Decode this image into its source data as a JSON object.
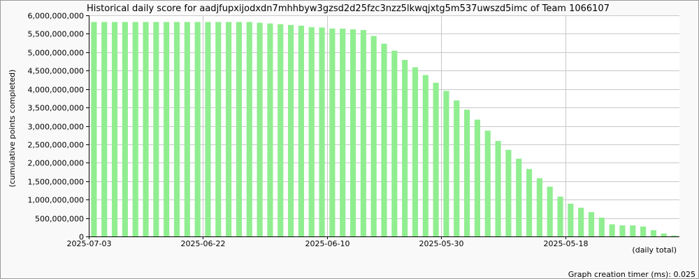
{
  "chart_data": {
    "type": "bar",
    "title": "Historical daily score for aadjfupxijodxdn7mhhbyw3gzsd2d25fzc3nzz5lkwqjxtg5m537uwszd5imc of Team 1066107",
    "xlabel": "(daily total)",
    "ylabel": "(cumulative points completed)",
    "ylim": [
      0,
      6000000000
    ],
    "yticks": [
      0,
      500000000,
      1000000000,
      1500000000,
      2000000000,
      2500000000,
      3000000000,
      3500000000,
      4000000000,
      4500000000,
      5000000000,
      5500000000,
      6000000000
    ],
    "ytick_labels": [
      "0",
      "500,000,000",
      "1,000,000,000",
      "1,500,000,000",
      "2,000,000,000",
      "2,500,000,000",
      "3,000,000,000",
      "3,500,000,000",
      "4,000,000,000",
      "4,500,000,000",
      "5,000,000,000",
      "5,500,000,000",
      "6,000,000,000"
    ],
    "xtick_labels": [
      {
        "index": 0,
        "label": "2025-07-03"
      },
      {
        "index": 11,
        "label": "2025-06-22"
      },
      {
        "index": 23,
        "label": "2025-06-10"
      },
      {
        "index": 34,
        "label": "2025-05-30"
      },
      {
        "index": 46,
        "label": "2025-05-18"
      }
    ],
    "grid": true,
    "bar_color": "#90ee90",
    "values": [
      5820000000,
      5820000000,
      5820000000,
      5820000000,
      5820000000,
      5820000000,
      5820000000,
      5820000000,
      5820000000,
      5820000000,
      5820000000,
      5820000000,
      5820000000,
      5820000000,
      5820000000,
      5820000000,
      5800000000,
      5780000000,
      5760000000,
      5740000000,
      5720000000,
      5680000000,
      5670000000,
      5640000000,
      5640000000,
      5620000000,
      5600000000,
      5440000000,
      5230000000,
      5040000000,
      4790000000,
      4590000000,
      4380000000,
      4170000000,
      3950000000,
      3690000000,
      3440000000,
      3170000000,
      2870000000,
      2590000000,
      2350000000,
      2110000000,
      1830000000,
      1580000000,
      1350000000,
      1080000000,
      890000000,
      780000000,
      660000000,
      510000000,
      330000000,
      300000000,
      300000000,
      270000000,
      170000000,
      80000000,
      25000000
    ]
  },
  "footer": {
    "timer_text": "Graph creation timer (ms): 0.025"
  }
}
